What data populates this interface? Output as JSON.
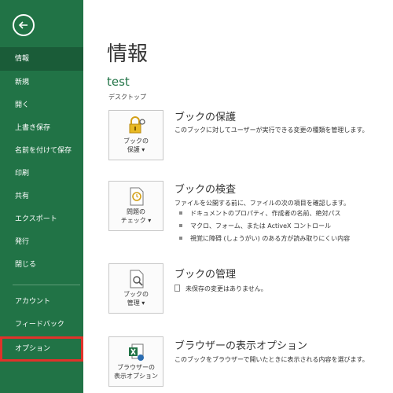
{
  "sidebar": {
    "items": [
      {
        "label": "情報"
      },
      {
        "label": "新規"
      },
      {
        "label": "開く"
      },
      {
        "label": "上書き保存"
      },
      {
        "label": "名前を付けて保存"
      },
      {
        "label": "印刷"
      },
      {
        "label": "共有"
      },
      {
        "label": "エクスポート"
      },
      {
        "label": "発行"
      },
      {
        "label": "閉じる"
      },
      {
        "label": "アカウント"
      },
      {
        "label": "フィードバック"
      },
      {
        "label": "オプション"
      }
    ],
    "selected": "情報",
    "highlighted": "オプション",
    "accent_color": "#217346",
    "highlight_color": "#e0322a"
  },
  "main": {
    "title": "情報",
    "file_name": "test",
    "file_location": "デスクトップ",
    "sections": {
      "protect": {
        "button_label": "ブックの\n保護 ▾",
        "icon": "lock-key-icon",
        "title": "ブックの保護",
        "description": "このブックに対してユーザーが実行できる変更の種類を管理します。"
      },
      "inspect": {
        "button_label": "問題の\nチェック ▾",
        "icon": "inspect-document-icon",
        "title": "ブックの検査",
        "description": "ファイルを公開する前に、ファイルの次の項目を確認します。",
        "bullets": [
          "ドキュメントのプロパティ、作成者の名前、絶対パス",
          "マクロ、フォーム、または ActiveX コントロール",
          "視覚に障碍 (しょうがい) のある方が読み取りにくい内容"
        ]
      },
      "manage": {
        "button_label": "ブックの\n管理 ▾",
        "icon": "manage-workbook-icon",
        "title": "ブックの管理",
        "status": "未保存の変更はありません。"
      },
      "browser": {
        "button_label": "ブラウザーの\n表示オプション",
        "icon": "excel-browser-icon",
        "title": "ブラウザーの表示オプション",
        "description": "このブックをブラウザーで開いたときに表示される内容を選びます。"
      }
    }
  }
}
